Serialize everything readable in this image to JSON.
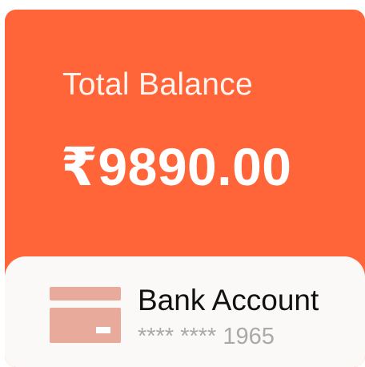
{
  "balance": {
    "label": "Total Balance",
    "amount": "₹9890.00"
  },
  "account": {
    "icon": "credit-card-icon",
    "title": "Bank Account",
    "masked_number": "**** **** 1965"
  },
  "colors": {
    "card_background": "#ff6539",
    "panel_background": "#faf9f8",
    "icon_fill": "#e8aa9a"
  }
}
